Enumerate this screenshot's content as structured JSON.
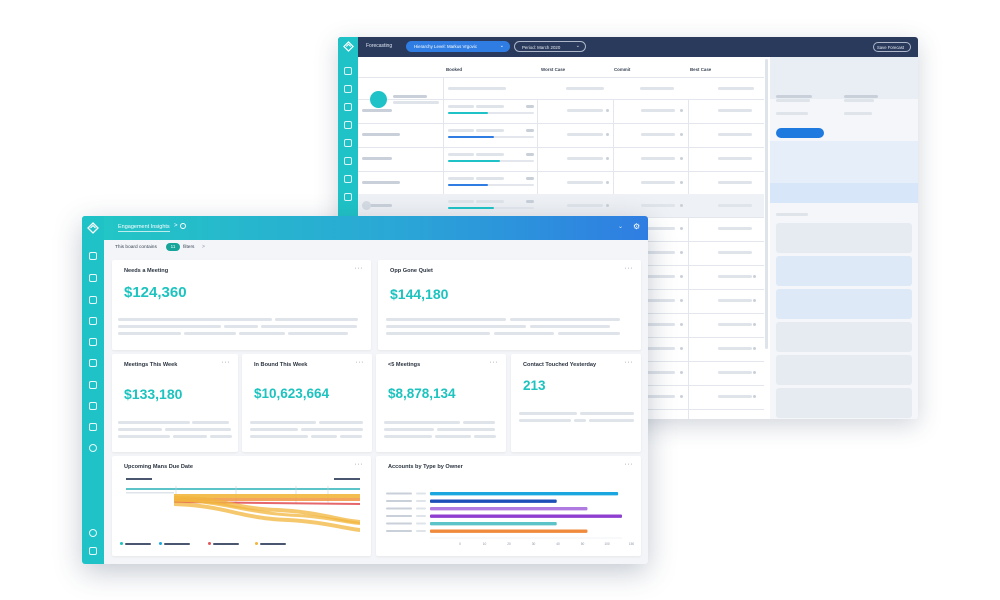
{
  "back_window": {
    "title": "Forecasting",
    "hierarchy_pill": "Hierarchy Level: Markus Vrgovic",
    "period_pill": "Period: March 2020",
    "save_button": "Save Forecast",
    "columns": [
      "Booked",
      "Worst Case",
      "Commit",
      "Best Case"
    ]
  },
  "front_window": {
    "breadcrumb": "Engagement Insights",
    "breadcrumb_arrow": ">",
    "filter_text": "This board contains",
    "filter_count": "11",
    "filter_label": "filters",
    "filter_arrow": ">",
    "more_icon_text": "···",
    "cards": [
      {
        "title": "Needs a Meeting",
        "value": "$124,360"
      },
      {
        "title": "Opp Gone Quiet",
        "value": "$144,180"
      },
      {
        "title": "Meetings This Week",
        "value": "$133,180"
      },
      {
        "title": "In Bound This Week",
        "value": "$10,623,664"
      },
      {
        "title": "<5 Meetings",
        "value": "$8,878,134"
      },
      {
        "title": "Contact Touched Yesterday",
        "value": "213"
      },
      {
        "title": "Upcoming Mans Due Date"
      },
      {
        "title": "Accounts by Type by Owner"
      }
    ],
    "bar_chart": {
      "colors": [
        "#1aa7e0",
        "#1d4fb8",
        "#b07be0",
        "#8e3fd0",
        "#5cc3c8",
        "#f08a3c"
      ],
      "values": [
        0.98,
        0.66,
        0.82,
        1.0,
        0.66,
        0.82
      ],
      "ticks": [
        "0",
        "10",
        "20",
        "30",
        "40",
        "50",
        "100",
        "150"
      ]
    },
    "sankey_colors": [
      "#f2b63c",
      "#f39a4a",
      "#e2575b",
      "#5cc3c8"
    ],
    "legend_dot_colors": [
      "#1cc3bf",
      "#1aa7e0",
      "#e2575b",
      "#f2b63c"
    ]
  }
}
